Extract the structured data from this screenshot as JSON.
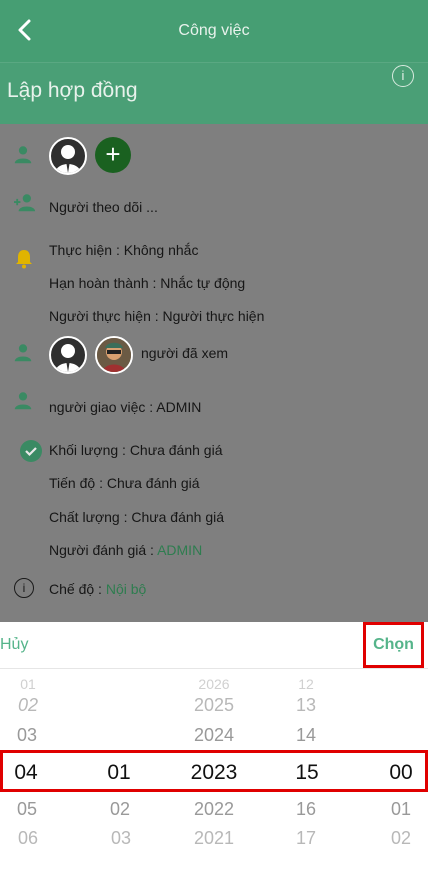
{
  "nav": {
    "title": "Công việc"
  },
  "header": {
    "title": "Lập hợp đồng",
    "info_icon": "info-icon"
  },
  "detail": {
    "followers_label": "Người theo dõi ...",
    "reminder": "Thực hiện : Không nhắc",
    "deadline": "Hạn hoàn thành : Nhắc tự động",
    "assignee": "Người thực hiện : Người thực hiện",
    "viewed_label": "người đã xem",
    "assigner": "người giao việc : ADMIN",
    "volume": "Khối lượng : Chưa đánh giá",
    "progress": "Tiến độ : Chưa đánh giá",
    "quality": "Chất lượng : Chưa đánh giá",
    "evaluator_prefix": "Người đánh giá : ",
    "evaluator_value": "ADMIN",
    "mode_prefix": "Chế độ : ",
    "mode_value": "Nội bộ"
  },
  "picker": {
    "cancel_label": "Hủy",
    "choose_label": "Chọn",
    "col1": {
      "above2": "01",
      "above1": "02",
      "above0": "03",
      "selected": "04",
      "below0": "05",
      "below1": "06"
    },
    "col2": {
      "below0": "02",
      "below1": "03",
      "selected": "01"
    },
    "col3": {
      "above2": "2026",
      "above1": "2025",
      "above0": "2024",
      "selected": "2023",
      "below0": "2022",
      "below1": "2021"
    },
    "col4": {
      "above2": "12",
      "above1": "13",
      "above0": "14",
      "selected": "15",
      "below0": "16",
      "below1": "17"
    },
    "col5": {
      "selected": "00",
      "below0": "01",
      "below1": "02"
    }
  }
}
